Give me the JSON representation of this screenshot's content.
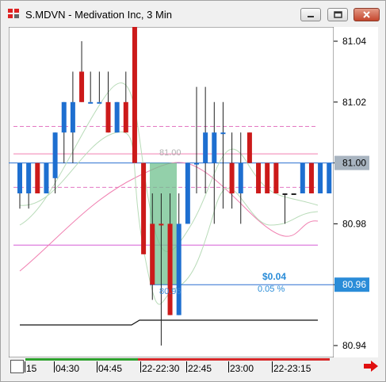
{
  "window": {
    "title": "S.MDVN - Medivation Inc, 3 Min",
    "buttons": [
      "minimize-icon",
      "restore-icon",
      "close-icon"
    ]
  },
  "price_axis": {
    "ticks": [
      "81.04",
      "81.02",
      "81.00",
      "80.98",
      "80.96",
      "80.94"
    ],
    "current_price_label": "81.00",
    "position_price_label": "80.96",
    "ylim": [
      80.935,
      81.05
    ]
  },
  "time_axis": {
    "ticks": [
      "15",
      "04:30",
      "04:45",
      "22-22:30",
      "22:45",
      "23:00",
      "22-23:15"
    ]
  },
  "position": {
    "pnl": "$0.04",
    "pnl_percent": "0.05 %",
    "entry_price_label": "80.96"
  },
  "overlay_labels": {
    "ghost_price": "81.00"
  },
  "colors": {
    "up": "#1e6fd0",
    "down": "#cc1a1a",
    "position_fill": "#6fc08e",
    "current_price_line": "#2a6fd0",
    "price_label_bg": "#2a8cd8",
    "accent_red_arrow": "#e01010"
  },
  "chart_data": {
    "type": "bar",
    "title": "",
    "ylabel": "",
    "xlabel": "",
    "ylim": [
      80.935,
      81.05
    ],
    "bars": [
      {
        "o": 80.99,
        "h": 81.0,
        "l": 80.985,
        "c": 81.0,
        "dir": "up"
      },
      {
        "o": 80.99,
        "h": 81.0,
        "l": 80.985,
        "c": 81.0,
        "dir": "up"
      },
      {
        "o": 81.0,
        "h": 81.0,
        "l": 80.99,
        "c": 80.99,
        "dir": "down"
      },
      {
        "o": 80.99,
        "h": 81.0,
        "l": 80.99,
        "c": 81.0,
        "dir": "up"
      },
      {
        "o": 80.995,
        "h": 81.01,
        "l": 80.99,
        "c": 81.01,
        "dir": "up"
      },
      {
        "o": 81.01,
        "h": 81.02,
        "l": 81.0,
        "c": 81.02,
        "dir": "up"
      },
      {
        "o": 81.01,
        "h": 81.03,
        "l": 81.0,
        "c": 81.02,
        "dir": "up"
      },
      {
        "o": 81.03,
        "h": 81.04,
        "l": 81.02,
        "c": 81.02,
        "dir": "down"
      },
      {
        "o": 81.02,
        "h": 81.03,
        "l": 81.02,
        "c": 81.02,
        "dir": "up"
      },
      {
        "o": 81.02,
        "h": 81.03,
        "l": 81.02,
        "c": 81.02,
        "dir": "up"
      },
      {
        "o": 81.02,
        "h": 81.03,
        "l": 81.01,
        "c": 81.01,
        "dir": "down"
      },
      {
        "o": 81.01,
        "h": 81.02,
        "l": 81.01,
        "c": 81.02,
        "dir": "up"
      },
      {
        "o": 81.02,
        "h": 81.03,
        "l": 81.01,
        "c": 81.01,
        "dir": "down"
      },
      {
        "o": 81.05,
        "h": 81.05,
        "l": 81.0,
        "c": 81.0,
        "dir": "down"
      },
      {
        "o": 81.0,
        "h": 81.0,
        "l": 80.97,
        "c": 80.97,
        "dir": "down"
      },
      {
        "o": 80.98,
        "h": 80.99,
        "l": 80.955,
        "c": 80.96,
        "dir": "down"
      },
      {
        "o": 80.98,
        "h": 80.99,
        "l": 80.94,
        "c": 80.98,
        "dir": "down"
      },
      {
        "o": 80.98,
        "h": 80.99,
        "l": 80.95,
        "c": 80.95,
        "dir": "down"
      },
      {
        "o": 80.95,
        "h": 80.99,
        "l": 80.95,
        "c": 80.98,
        "dir": "up"
      },
      {
        "o": 80.98,
        "h": 81.0,
        "l": 80.98,
        "c": 81.0,
        "dir": "up"
      },
      {
        "o": 81.0,
        "h": 81.025,
        "l": 80.99,
        "c": 81.0,
        "dir": "up"
      },
      {
        "o": 81.0,
        "h": 81.025,
        "l": 80.99,
        "c": 81.01,
        "dir": "up"
      },
      {
        "o": 81.0,
        "h": 81.02,
        "l": 80.98,
        "c": 81.01,
        "dir": "up"
      },
      {
        "o": 81.01,
        "h": 81.02,
        "l": 80.985,
        "c": 81.01,
        "dir": "up"
      },
      {
        "o": 81.0,
        "h": 81.01,
        "l": 80.985,
        "c": 80.99,
        "dir": "down"
      },
      {
        "o": 80.99,
        "h": 81.01,
        "l": 80.98,
        "c": 81.0,
        "dir": "up"
      },
      {
        "o": 81.01,
        "h": 81.01,
        "l": 81.0,
        "c": 81.0,
        "dir": "down"
      },
      {
        "o": 81.0,
        "h": 81.0,
        "l": 80.99,
        "c": 80.99,
        "dir": "down"
      },
      {
        "o": 81.0,
        "h": 81.0,
        "l": 80.99,
        "c": 80.99,
        "dir": "down"
      },
      {
        "o": 81.0,
        "h": 81.0,
        "l": 80.99,
        "c": 80.99,
        "dir": "down"
      },
      {
        "o": 80.99,
        "h": 80.99,
        "l": 80.98,
        "c": 80.99,
        "dir": "flat"
      },
      {
        "o": 80.99,
        "h": 80.99,
        "l": 80.99,
        "c": 80.99,
        "dir": "flat"
      },
      {
        "o": 80.99,
        "h": 81.0,
        "l": 80.99,
        "c": 81.0,
        "dir": "up"
      },
      {
        "o": 81.0,
        "h": 81.0,
        "l": 80.99,
        "c": 80.99,
        "dir": "down"
      },
      {
        "o": 80.99,
        "h": 81.0,
        "l": 80.99,
        "c": 81.0,
        "dir": "up"
      },
      {
        "o": 80.99,
        "h": 81.0,
        "l": 80.99,
        "c": 81.0,
        "dir": "up"
      }
    ],
    "reference_lines": [
      {
        "price": 81.049,
        "style": "solid",
        "color": "#888888"
      },
      {
        "price": 81.012,
        "style": "dashed",
        "color": "#e377c2"
      },
      {
        "price": 81.003,
        "style": "solid",
        "color": "#f07fb0"
      },
      {
        "price": 81.0,
        "style": "solid",
        "color": "#2a6fd0"
      },
      {
        "price": 80.992,
        "style": "dashed",
        "color": "#e377c2"
      },
      {
        "price": 80.973,
        "style": "solid",
        "color": "#d65fd6"
      }
    ]
  }
}
